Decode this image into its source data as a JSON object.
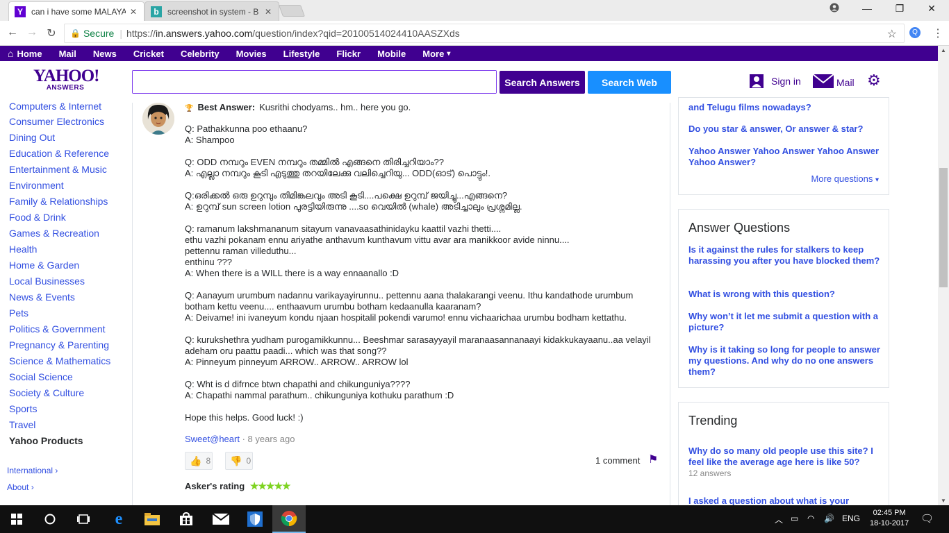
{
  "browser": {
    "tabs": [
      {
        "title": "can i have some MALAYA",
        "favicon": "Y",
        "favicon_color": "#6001d2"
      },
      {
        "title": "screenshot in system - B",
        "favicon": "b",
        "favicon_color": "#2aa5a5"
      }
    ],
    "secure_label": "Secure",
    "url_prefix": "https://",
    "url_domain": "in.answers.yahoo.com",
    "url_path": "/question/index?qid=20100514024410AASZXds"
  },
  "nav": {
    "home": "Home",
    "items": [
      "Mail",
      "News",
      "Cricket",
      "Celebrity",
      "Movies",
      "Lifestyle",
      "Flickr",
      "Mobile"
    ],
    "more": "More"
  },
  "header": {
    "logo_top": "YAHOO!",
    "logo_bottom": "ANSWERS",
    "search_answers": "Search Answers",
    "search_web": "Search Web",
    "sign_in": "Sign in",
    "mail": "Mail"
  },
  "sidebar": {
    "partial_top": "Computers & Internet",
    "categories": [
      "Consumer Electronics",
      "Dining Out",
      "Education & Reference",
      "Entertainment & Music",
      "Environment",
      "Family & Relationships",
      "Food & Drink",
      "Games & Recreation",
      "Health",
      "Home & Garden",
      "Local Businesses",
      "News & Events",
      "Pets",
      "Politics & Government",
      "Pregnancy & Parenting",
      "Science & Mathematics",
      "Social Science",
      "Society & Culture",
      "Sports",
      "Travel"
    ],
    "yahoo_products": "Yahoo Products",
    "international": "International",
    "about": "About"
  },
  "answer": {
    "best_label": "Best Answer:",
    "best_text": "Kusrithi chodyams.. hm.. here you go.",
    "lines": [
      "Q: Pathakkunna poo ethaanu?",
      "A: Shampoo",
      "",
      "Q: ODD നമ്പറും EVEN നമ്പറും തമ്മിൽ എങ്ങനെ തിരിച്ചറിയാം??",
      "A: എല്ലാ നമ്പറും കൂടി എടുത്തു തറയിലേക്കു വലിച്ചെറിയു... ODD(ഓട്) പൊട്ടും!.",
      "",
      "Q:ഒരിക്കൽ ഒരു ഉറുമ്പും തിമിങ്കലവും അടി കൂടി....പക്ഷെ ഉറുമ്പ് ജയിച്ചു...എങ്ങനെ?",
      "A: ഉറുമ്പ് sun screen lotion പുരട്ടിയിരുന്നു ....so വെയിൽ (whale) അടിച്ചാലും പ്രശ്നമില്ല.",
      "",
      "Q: ramanum lakshmananum sitayum vanavaasathinidayku kaattil vazhi thetti....",
      "ethu vazhi pokanam ennu ariyathe anthavum kunthavum vittu avar ara manikkoor avide ninnu....",
      "pettennu raman villeduthu...",
      "enthinu ???",
      "A: When there is a WILL there is a way ennaanallo :D",
      "",
      "Q: Aanayum urumbum nadannu varikayayirunnu.. pettennu aana thalakarangi veenu. Ithu kandathode urumbum",
      "botham kettu veenu.... enthaavum urumbu botham kedaanulla kaaranam?",
      "A: Deivame! ini ivaneyum kondu njaan hospitalil pokendi varumo! ennu vichaarichaa urumbu bodham kettathu.",
      "",
      "Q: kurukshethra yudham purogamikkunnu... Beeshmar sarasayyayil maranaasannanaayi kidakkukayaanu..aa velayil",
      "adeham oru paattu paadi... which was that song??",
      "A: Pinneyum pinneyum ARROW.. ARROW.. ARROW lol",
      "",
      "Q: Wht is d difrnce btwn chapathi and chikunguniya????",
      "A: Chapathi nammal parathum.. chikunguniya kothuku parathum :D",
      "",
      "Hope this helps. Good luck! :)"
    ],
    "author": "Sweet@heart",
    "age": "8 years ago",
    "upvotes": "8",
    "downvotes": "0",
    "comments": "1 comment",
    "askers_rating_label": "Asker's rating",
    "rating_stars": "★★★★★",
    "rating_value": 5
  },
  "right": {
    "related_partial": "and Telugu films nowadays?",
    "related": [
      "Do you star & answer, Or answer & star?",
      "Yahoo Answer Yahoo Answer Yahoo Answer Yahoo Answer?"
    ],
    "more_questions": "More questions",
    "answer_questions_title": "Answer Questions",
    "answer_questions": [
      "Is it against the rules for stalkers to keep harassing you after you have blocked them?",
      "What is wrong with this question?",
      "Why won’t it let me submit a question with a picture?",
      "Why is it taking so long for people to answer my questions. And why do no one answers them?"
    ],
    "trending_title": "Trending",
    "trending": [
      {
        "q": "Why do so many old people use this site? I feel like the average age here is like 50?",
        "answers": "12 answers"
      },
      {
        "q": "I asked a question about what is your",
        "answers": ""
      }
    ]
  },
  "taskbar": {
    "lang": "ENG",
    "time": "02:45 PM",
    "date": "18-10-2017"
  }
}
